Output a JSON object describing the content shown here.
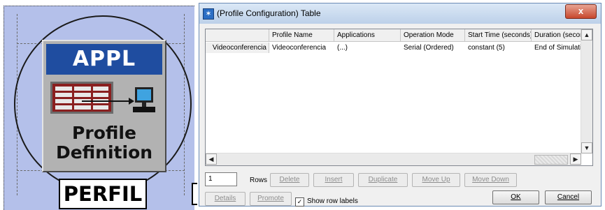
{
  "node": {
    "header": "APPL",
    "label_line1": "Profile",
    "label_line2": "Definition",
    "name": "PERFIL",
    "colors": {
      "header": "#1f4da0",
      "selection": "#b4c0ea"
    }
  },
  "dialog": {
    "title": "(Profile Configuration) Table",
    "close_glyph": "x",
    "columns": [
      "",
      "Profile Name",
      "Applications",
      "Operation Mode",
      "Start Time (seconds)",
      "Duration (secor"
    ],
    "rows": [
      [
        "Videoconferencia",
        "Videoconferencia",
        "(...)",
        "Serial (Ordered)",
        "constant (5)",
        "End of Simulatio"
      ]
    ],
    "rows_value": "1",
    "rows_label": "Rows",
    "buttons": {
      "delete": "Delete",
      "insert": "Insert",
      "duplicate": "Duplicate",
      "move_up": "Move Up",
      "move_down": "Move Down",
      "details": "Details",
      "promote": "Promote",
      "ok": "OK",
      "cancel": "Cancel"
    },
    "show_row_labels": {
      "label": "Show row labels",
      "checked": true
    }
  }
}
